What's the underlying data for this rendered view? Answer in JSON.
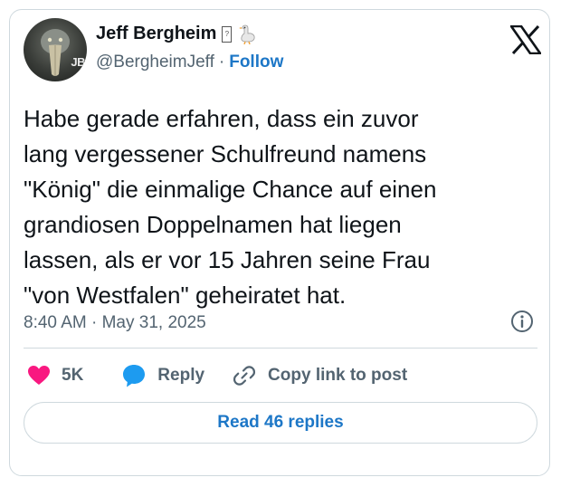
{
  "author": {
    "display_name": "Jeff Bergheim",
    "name_badge": "?",
    "emoji_icon": "goose-icon",
    "avatar_badge": "JB",
    "handle": "@BergheimJeff",
    "separator": "·",
    "follow_label": "Follow"
  },
  "tweet": {
    "text": "Habe gerade erfahren, dass ein zuvor\nlang vergessener Schulfreund namens\n\"König\" die einmalige Chance auf einen\ngrandiosen Doppelnamen hat liegen\nlassen, als er vor 15 Jahren seine Frau\n\"von Westfalen\" geheiratet hat.",
    "time": "8:40 AM",
    "separator": "·",
    "date": "May 31, 2025"
  },
  "actions": {
    "like_count": "5K",
    "reply_label": "Reply",
    "copy_link_label": "Copy link to post"
  },
  "read_replies_label": "Read 46 replies",
  "colors": {
    "like": "#f91880",
    "reply": "#1d9bf0",
    "link": "#1d77c7",
    "muted": "#536471"
  }
}
